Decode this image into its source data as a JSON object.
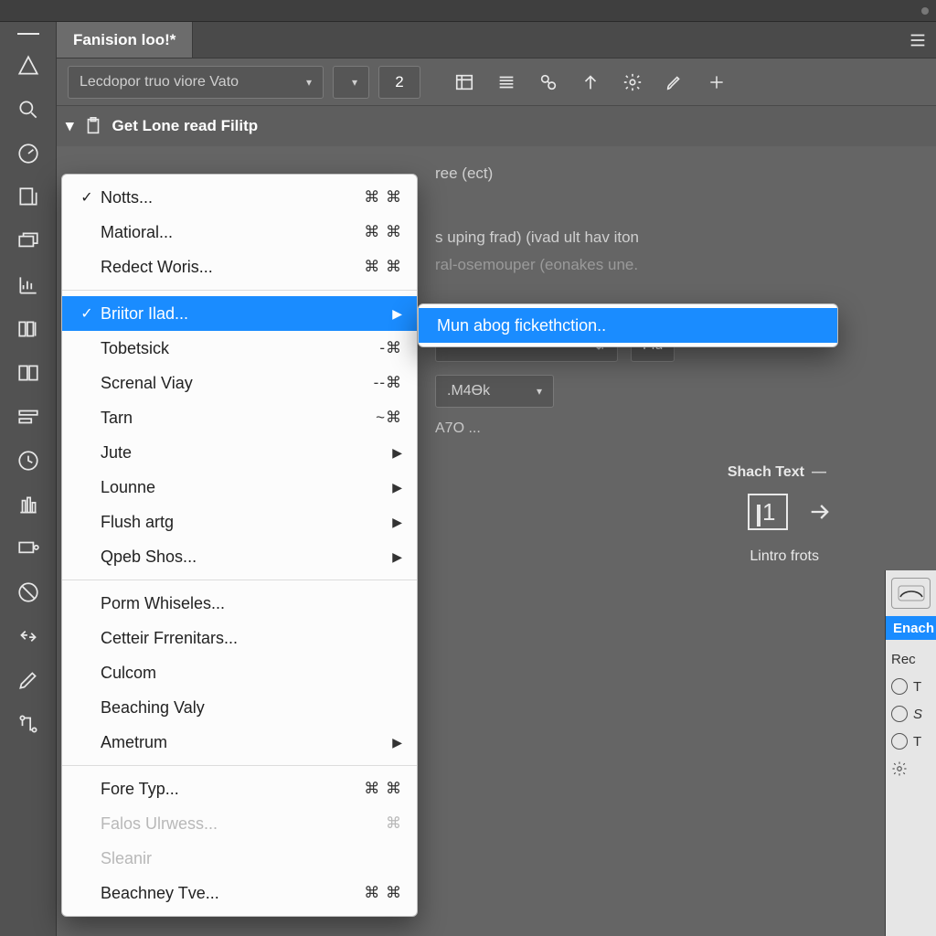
{
  "tab": {
    "title": "Fanision loo!*"
  },
  "toolbar": {
    "selector_label": "Lecdopor truo viore Vato",
    "number_value": "2"
  },
  "subheader": {
    "title": "Get Lone read Filitp"
  },
  "canvas": {
    "line1": "ree (ect)",
    "line2": "s uping frad) (ivad ult hav iton",
    "line3": "ral-osemouper (eonakes une.",
    "select_empty": "",
    "flu_btn": "Flu",
    "m4k_label": ".M4Ɵk",
    "a70_label": "A7O ...",
    "shach_label": "Shach Text",
    "lintro_label": "Lintro frots"
  },
  "right_dock": {
    "enach_label": "Enach",
    "rec_label": "Rec",
    "rows": [
      "T",
      "S",
      "T"
    ]
  },
  "menu": {
    "items": [
      {
        "label": "Notts...",
        "checked": true,
        "shortcut": "⌘ ⌘",
        "submenu": false
      },
      {
        "label": "Matioral...",
        "checked": false,
        "shortcut": "⌘ ⌘",
        "submenu": false
      },
      {
        "label": "Redect Woris...",
        "checked": false,
        "shortcut": "⌘ ⌘",
        "submenu": false
      },
      {
        "sep": true
      },
      {
        "label": "Briitor Ilad...",
        "checked": true,
        "shortcut": "",
        "submenu": true,
        "hover": true
      },
      {
        "label": "Tobetsick",
        "checked": false,
        "shortcut": "-⌘",
        "submenu": false
      },
      {
        "label": "Screnal Viay",
        "checked": false,
        "shortcut": "--⌘",
        "submenu": false
      },
      {
        "label": "Tarn",
        "checked": false,
        "shortcut": "~⌘",
        "submenu": false
      },
      {
        "label": "Jute",
        "checked": false,
        "shortcut": "",
        "submenu": true
      },
      {
        "label": "Lounne",
        "checked": false,
        "shortcut": "",
        "submenu": true
      },
      {
        "label": "Flush artg",
        "checked": false,
        "shortcut": "",
        "submenu": true
      },
      {
        "label": "Qpeb Shos...",
        "checked": false,
        "shortcut": "",
        "submenu": true
      },
      {
        "sep": true
      },
      {
        "label": "Porm Whiseles...",
        "checked": false,
        "shortcut": "",
        "submenu": false
      },
      {
        "label": "Cetteir Frrenitars...",
        "checked": false,
        "shortcut": "",
        "submenu": false
      },
      {
        "label": "Culcom",
        "checked": false,
        "shortcut": "",
        "submenu": false
      },
      {
        "label": "Beaching Valy",
        "checked": false,
        "shortcut": "",
        "submenu": false
      },
      {
        "label": "Ametrum",
        "checked": false,
        "shortcut": "",
        "submenu": true
      },
      {
        "sep": true
      },
      {
        "label": "Fore Typ...",
        "checked": false,
        "shortcut": "⌘ ⌘",
        "submenu": false
      },
      {
        "label": "Falos Ulrwess...",
        "checked": false,
        "shortcut": "⌘",
        "submenu": false,
        "dim": true
      },
      {
        "label": "Sleanir",
        "checked": false,
        "shortcut": "",
        "submenu": false,
        "dim": true
      },
      {
        "label": "Beachney Tve...",
        "checked": false,
        "shortcut": "⌘ ⌘",
        "submenu": false
      }
    ]
  },
  "submenu": {
    "item_label": "Mun abog fickethction.."
  }
}
